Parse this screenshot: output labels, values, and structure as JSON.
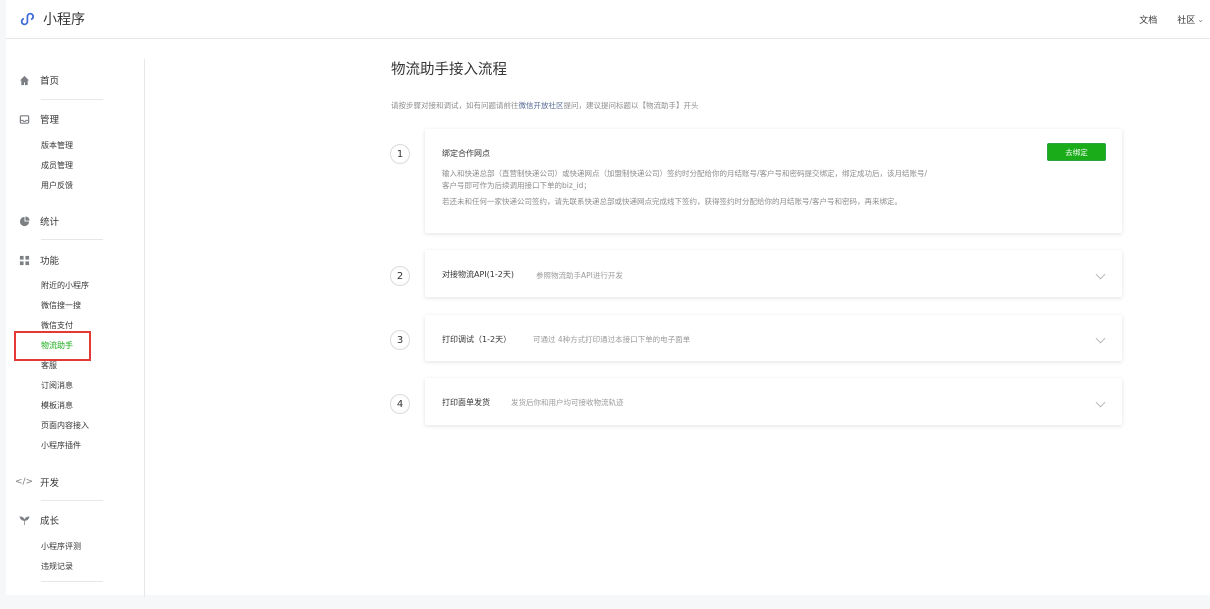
{
  "topbar": {
    "brand": "小程序",
    "links": {
      "docs": "文档",
      "community": "社区"
    }
  },
  "sidebar": {
    "groups": [
      {
        "label": "首页",
        "icon": "home-icon",
        "items": []
      },
      {
        "label": "管理",
        "icon": "inbox-icon",
        "items": [
          "版本管理",
          "成员管理",
          "用户反馈"
        ]
      },
      {
        "label": "统计",
        "icon": "pie-chart-icon",
        "items": []
      },
      {
        "label": "功能",
        "icon": "grid-icon",
        "items": [
          "附近的小程序",
          "微信搜一搜",
          "微信支付",
          "物流助手",
          "客服",
          "订阅消息",
          "模板消息",
          "页面内容接入",
          "小程序插件"
        ]
      },
      {
        "label": "开发",
        "icon": "code-icon",
        "items": []
      },
      {
        "label": "成长",
        "icon": "sprout-icon",
        "items": [
          "小程序评测",
          "违规记录"
        ]
      }
    ],
    "active_item": "物流助手"
  },
  "main": {
    "title": "物流助手接入流程",
    "intro_before": "请按步骤对接和调试，如有问题请前往",
    "intro_link": "微信开放社区",
    "intro_after": "提问，建议提问标题以【物流助手】开头",
    "steps": [
      {
        "number": "1",
        "title": "绑定合作网点",
        "button": "去绑定",
        "paragraphs": [
          "输入和快递总部（直营制快递公司）或快递网点（加盟制快递公司）签约时分配给你的月结账号/客户号和密码提交绑定，绑定成功后，该月结账号/",
          "客户号即可作为后续调用接口下单的biz_id；",
          "若还未和任何一家快递公司签约，请先联系快递总部或快递网点完成线下签约，获得签约时分配给你的月结账号/客户号和密码，再来绑定。"
        ]
      },
      {
        "number": "2",
        "title": "对接物流API(1-2天)",
        "desc": "参照物流助手API进行开发"
      },
      {
        "number": "3",
        "title": "打印调试（1-2天）",
        "desc": "可通过 4种方式打印通过本接口下单的电子面单"
      },
      {
        "number": "4",
        "title": "打印面单发货",
        "desc": "发货后你和用户均可接收物流轨迹"
      }
    ]
  },
  "colors": {
    "accent": "#1aad19",
    "link": "#576b95",
    "highlight": "#e53935"
  }
}
